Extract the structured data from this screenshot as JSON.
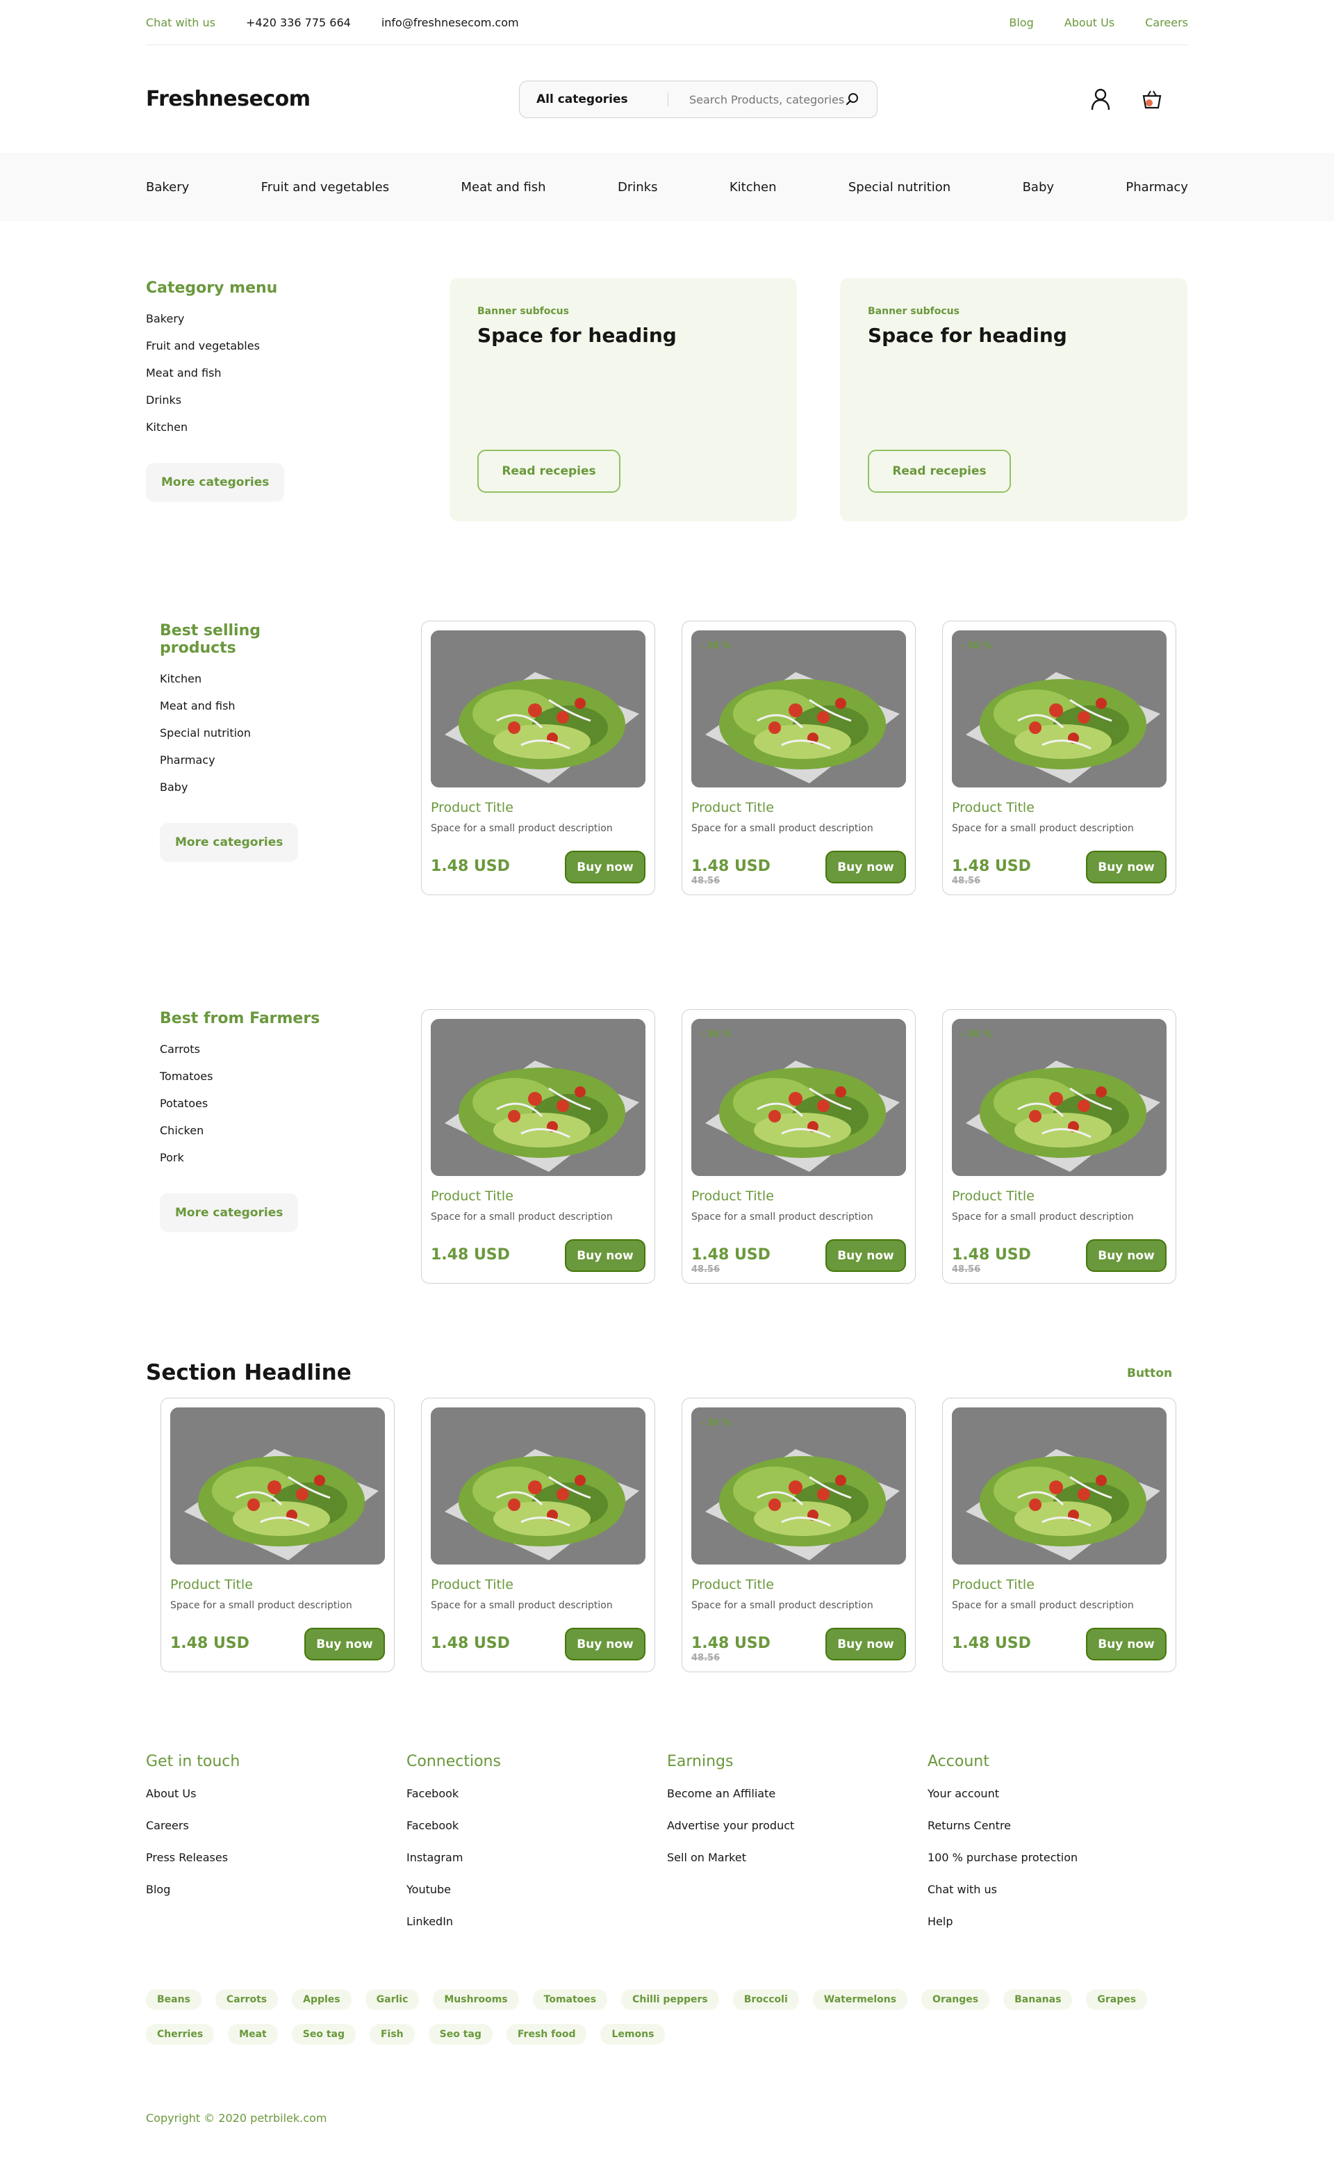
{
  "topbar": {
    "chat": "Chat with us",
    "phone": "+420 336 775 664",
    "email": "info@freshnesecom.com",
    "links": [
      "Blog",
      "About Us",
      "Careers"
    ]
  },
  "header": {
    "logo": "Freshnesecom",
    "category_select": "All categories",
    "search_placeholder": "Search Products, categories ..."
  },
  "nav": [
    "Bakery",
    "Fruit and vegetables",
    "Meat and fish",
    "Drinks",
    "Kitchen",
    "Special nutrition",
    "Baby",
    "Pharmacy"
  ],
  "category_menu": {
    "title": "Category menu",
    "items": [
      "Bakery",
      "Fruit and vegetables",
      "Meat and fish",
      "Drinks",
      "Kitchen"
    ],
    "more": "More categories"
  },
  "banners": [
    {
      "sub": "Banner subfocus",
      "heading": "Space for heading",
      "button": "Read recepies"
    },
    {
      "sub": "Banner subfocus",
      "heading": "Space for heading",
      "button": "Read recepies"
    }
  ],
  "best_selling": {
    "title": "Best selling products",
    "items": [
      "Kitchen",
      "Meat and fish",
      "Special nutrition",
      "Pharmacy",
      "Baby"
    ],
    "more": "More categories"
  },
  "farmers": {
    "title": "Best from Farmers",
    "items": [
      "Carrots",
      "Tomatoes",
      "Potatoes",
      "Chicken",
      "Pork"
    ],
    "more": "More categories"
  },
  "product": {
    "title": "Product Title",
    "desc": "Space for a small product description",
    "price": "1.48 USD",
    "old_price": "48.56",
    "discount": "- 36 %",
    "buy": "Buy now"
  },
  "section": {
    "headline": "Section Headline",
    "button": "Button"
  },
  "footer": {
    "columns": [
      {
        "title": "Get in touch",
        "links": [
          "About Us",
          "Careers",
          "Press Releases",
          "Blog"
        ]
      },
      {
        "title": "Connections",
        "links": [
          "Facebook",
          "Facebook",
          "Instagram",
          "Youtube",
          "LinkedIn"
        ]
      },
      {
        "title": "Earnings",
        "links": [
          "Become an Affiliate",
          "Advertise your product",
          "Sell on Market"
        ]
      },
      {
        "title": "Account",
        "links": [
          "Your account",
          "Returns Centre",
          "100 % purchase protection",
          "Chat with us",
          "Help"
        ]
      }
    ],
    "tags": [
      "Beans",
      "Carrots",
      "Apples",
      "Garlic",
      "Mushrooms",
      "Tomatoes",
      "Chilli peppers",
      "Broccoli",
      "Watermelons",
      "Oranges",
      "Bananas",
      "Grapes",
      "Cherries",
      "Meat",
      "Seo tag",
      "Fish",
      "Seo tag",
      "Fresh food",
      "Lemons"
    ],
    "copyright": "Copyright © 2020 petrbilek.com"
  }
}
